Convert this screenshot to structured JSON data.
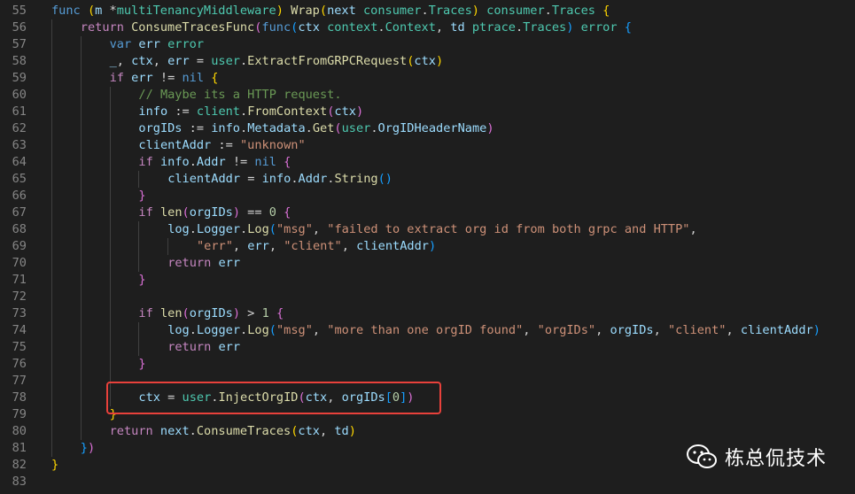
{
  "editor": {
    "lines": [
      {
        "n": "55",
        "indent": 0,
        "tokens": [
          [
            "kw",
            "func"
          ],
          [
            "pl",
            " "
          ],
          [
            "br1",
            "("
          ],
          [
            "var",
            "m"
          ],
          [
            "pl",
            " *"
          ],
          [
            "ty",
            "multiTenancyMiddleware"
          ],
          [
            "br1",
            ")"
          ],
          [
            "pl",
            " "
          ],
          [
            "fn",
            "Wrap"
          ],
          [
            "br1",
            "("
          ],
          [
            "var",
            "next"
          ],
          [
            "pl",
            " "
          ],
          [
            "ty",
            "consumer"
          ],
          [
            "pl",
            "."
          ],
          [
            "ty",
            "Traces"
          ],
          [
            "br1",
            ")"
          ],
          [
            "pl",
            " "
          ],
          [
            "ty",
            "consumer"
          ],
          [
            "pl",
            "."
          ],
          [
            "ty",
            "Traces"
          ],
          [
            "pl",
            " "
          ],
          [
            "br1",
            "{"
          ]
        ]
      },
      {
        "n": "56",
        "indent": 1,
        "tokens": [
          [
            "ctl",
            "return"
          ],
          [
            "pl",
            " "
          ],
          [
            "fn",
            "ConsumeTracesFunc"
          ],
          [
            "br2",
            "("
          ],
          [
            "kw",
            "func"
          ],
          [
            "br3",
            "("
          ],
          [
            "var",
            "ctx"
          ],
          [
            "pl",
            " "
          ],
          [
            "ty",
            "context"
          ],
          [
            "pl",
            "."
          ],
          [
            "ty",
            "Context"
          ],
          [
            "pl",
            ", "
          ],
          [
            "var",
            "td"
          ],
          [
            "pl",
            " "
          ],
          [
            "ty",
            "ptrace"
          ],
          [
            "pl",
            "."
          ],
          [
            "ty",
            "Traces"
          ],
          [
            "br3",
            ")"
          ],
          [
            "pl",
            " "
          ],
          [
            "ty",
            "error"
          ],
          [
            "pl",
            " "
          ],
          [
            "br3",
            "{"
          ]
        ]
      },
      {
        "n": "57",
        "indent": 2,
        "tokens": [
          [
            "kw",
            "var"
          ],
          [
            "pl",
            " "
          ],
          [
            "var",
            "err"
          ],
          [
            "pl",
            " "
          ],
          [
            "ty",
            "error"
          ]
        ]
      },
      {
        "n": "58",
        "indent": 2,
        "tokens": [
          [
            "var",
            "_"
          ],
          [
            "pl",
            ", "
          ],
          [
            "var",
            "ctx"
          ],
          [
            "pl",
            ", "
          ],
          [
            "var",
            "err"
          ],
          [
            "pl",
            " = "
          ],
          [
            "ty",
            "user"
          ],
          [
            "pl",
            "."
          ],
          [
            "fn",
            "ExtractFromGRPCRequest"
          ],
          [
            "br1",
            "("
          ],
          [
            "var",
            "ctx"
          ],
          [
            "br1",
            ")"
          ]
        ]
      },
      {
        "n": "59",
        "indent": 2,
        "tokens": [
          [
            "ctl",
            "if"
          ],
          [
            "pl",
            " "
          ],
          [
            "var",
            "err"
          ],
          [
            "pl",
            " != "
          ],
          [
            "kw",
            "nil"
          ],
          [
            "pl",
            " "
          ],
          [
            "br1",
            "{"
          ]
        ]
      },
      {
        "n": "60",
        "indent": 3,
        "tokens": [
          [
            "com",
            "// Maybe its a HTTP request."
          ]
        ]
      },
      {
        "n": "61",
        "indent": 3,
        "tokens": [
          [
            "var",
            "info"
          ],
          [
            "pl",
            " := "
          ],
          [
            "ty",
            "client"
          ],
          [
            "pl",
            "."
          ],
          [
            "fn",
            "FromContext"
          ],
          [
            "br2",
            "("
          ],
          [
            "var",
            "ctx"
          ],
          [
            "br2",
            ")"
          ]
        ]
      },
      {
        "n": "62",
        "indent": 3,
        "tokens": [
          [
            "var",
            "orgIDs"
          ],
          [
            "pl",
            " := "
          ],
          [
            "var",
            "info"
          ],
          [
            "pl",
            "."
          ],
          [
            "var",
            "Metadata"
          ],
          [
            "pl",
            "."
          ],
          [
            "fn",
            "Get"
          ],
          [
            "br2",
            "("
          ],
          [
            "ty",
            "user"
          ],
          [
            "pl",
            "."
          ],
          [
            "var",
            "OrgIDHeaderName"
          ],
          [
            "br2",
            ")"
          ]
        ]
      },
      {
        "n": "63",
        "indent": 3,
        "tokens": [
          [
            "var",
            "clientAddr"
          ],
          [
            "pl",
            " := "
          ],
          [
            "str",
            "\"unknown\""
          ]
        ]
      },
      {
        "n": "64",
        "indent": 3,
        "tokens": [
          [
            "ctl",
            "if"
          ],
          [
            "pl",
            " "
          ],
          [
            "var",
            "info"
          ],
          [
            "pl",
            "."
          ],
          [
            "var",
            "Addr"
          ],
          [
            "pl",
            " != "
          ],
          [
            "kw",
            "nil"
          ],
          [
            "pl",
            " "
          ],
          [
            "br2",
            "{"
          ]
        ]
      },
      {
        "n": "65",
        "indent": 4,
        "tokens": [
          [
            "var",
            "clientAddr"
          ],
          [
            "pl",
            " = "
          ],
          [
            "var",
            "info"
          ],
          [
            "pl",
            "."
          ],
          [
            "var",
            "Addr"
          ],
          [
            "pl",
            "."
          ],
          [
            "fn",
            "String"
          ],
          [
            "br3",
            "()"
          ]
        ]
      },
      {
        "n": "66",
        "indent": 3,
        "tokens": [
          [
            "br2",
            "}"
          ]
        ]
      },
      {
        "n": "67",
        "indent": 3,
        "tokens": [
          [
            "ctl",
            "if"
          ],
          [
            "pl",
            " "
          ],
          [
            "fn",
            "len"
          ],
          [
            "br2",
            "("
          ],
          [
            "var",
            "orgIDs"
          ],
          [
            "br2",
            ")"
          ],
          [
            "pl",
            " == "
          ],
          [
            "num",
            "0"
          ],
          [
            "pl",
            " "
          ],
          [
            "br2",
            "{"
          ]
        ]
      },
      {
        "n": "68",
        "indent": 4,
        "tokens": [
          [
            "var",
            "log"
          ],
          [
            "pl",
            "."
          ],
          [
            "var",
            "Logger"
          ],
          [
            "pl",
            "."
          ],
          [
            "fn",
            "Log"
          ],
          [
            "br3",
            "("
          ],
          [
            "str",
            "\"msg\""
          ],
          [
            "pl",
            ", "
          ],
          [
            "str",
            "\"failed to extract org id from both grpc and HTTP\""
          ],
          [
            "pl",
            ","
          ]
        ]
      },
      {
        "n": "69",
        "indent": 5,
        "tokens": [
          [
            "str",
            "\"err\""
          ],
          [
            "pl",
            ", "
          ],
          [
            "var",
            "err"
          ],
          [
            "pl",
            ", "
          ],
          [
            "str",
            "\"client\""
          ],
          [
            "pl",
            ", "
          ],
          [
            "var",
            "clientAddr"
          ],
          [
            "br3",
            ")"
          ]
        ]
      },
      {
        "n": "70",
        "indent": 4,
        "tokens": [
          [
            "ctl",
            "return"
          ],
          [
            "pl",
            " "
          ],
          [
            "var",
            "err"
          ]
        ]
      },
      {
        "n": "71",
        "indent": 3,
        "tokens": [
          [
            "br2",
            "}"
          ]
        ]
      },
      {
        "n": "72",
        "indent": 3,
        "tokens": []
      },
      {
        "n": "73",
        "indent": 3,
        "tokens": [
          [
            "ctl",
            "if"
          ],
          [
            "pl",
            " "
          ],
          [
            "fn",
            "len"
          ],
          [
            "br2",
            "("
          ],
          [
            "var",
            "orgIDs"
          ],
          [
            "br2",
            ")"
          ],
          [
            "pl",
            " > "
          ],
          [
            "num",
            "1"
          ],
          [
            "pl",
            " "
          ],
          [
            "br2",
            "{"
          ]
        ]
      },
      {
        "n": "74",
        "indent": 4,
        "tokens": [
          [
            "var",
            "log"
          ],
          [
            "pl",
            "."
          ],
          [
            "var",
            "Logger"
          ],
          [
            "pl",
            "."
          ],
          [
            "fn",
            "Log"
          ],
          [
            "br3",
            "("
          ],
          [
            "str",
            "\"msg\""
          ],
          [
            "pl",
            ", "
          ],
          [
            "str",
            "\"more than one orgID found\""
          ],
          [
            "pl",
            ", "
          ],
          [
            "str",
            "\"orgIDs\""
          ],
          [
            "pl",
            ", "
          ],
          [
            "var",
            "orgIDs"
          ],
          [
            "pl",
            ", "
          ],
          [
            "str",
            "\"client\""
          ],
          [
            "pl",
            ", "
          ],
          [
            "var",
            "clientAddr"
          ],
          [
            "br3",
            ")"
          ]
        ]
      },
      {
        "n": "75",
        "indent": 4,
        "tokens": [
          [
            "ctl",
            "return"
          ],
          [
            "pl",
            " "
          ],
          [
            "var",
            "err"
          ]
        ]
      },
      {
        "n": "76",
        "indent": 3,
        "tokens": [
          [
            "br2",
            "}"
          ]
        ]
      },
      {
        "n": "77",
        "indent": 3,
        "tokens": []
      },
      {
        "n": "78",
        "indent": 3,
        "tokens": [
          [
            "var",
            "ctx"
          ],
          [
            "pl",
            " = "
          ],
          [
            "ty",
            "user"
          ],
          [
            "pl",
            "."
          ],
          [
            "fn",
            "InjectOrgID"
          ],
          [
            "br2",
            "("
          ],
          [
            "var",
            "ctx"
          ],
          [
            "pl",
            ", "
          ],
          [
            "var",
            "orgIDs"
          ],
          [
            "br3",
            "["
          ],
          [
            "num",
            "0"
          ],
          [
            "br3",
            "]"
          ],
          [
            "br2",
            ")"
          ]
        ]
      },
      {
        "n": "79",
        "indent": 2,
        "tokens": [
          [
            "br1",
            "}"
          ]
        ]
      },
      {
        "n": "80",
        "indent": 2,
        "tokens": [
          [
            "ctl",
            "return"
          ],
          [
            "pl",
            " "
          ],
          [
            "var",
            "next"
          ],
          [
            "pl",
            "."
          ],
          [
            "fn",
            "ConsumeTraces"
          ],
          [
            "br1",
            "("
          ],
          [
            "var",
            "ctx"
          ],
          [
            "pl",
            ", "
          ],
          [
            "var",
            "td"
          ],
          [
            "br1",
            ")"
          ]
        ]
      },
      {
        "n": "81",
        "indent": 1,
        "tokens": [
          [
            "br3",
            "}"
          ],
          [
            "br2",
            ")"
          ]
        ]
      },
      {
        "n": "82",
        "indent": 0,
        "tokens": [
          [
            "br1",
            "}"
          ]
        ]
      },
      {
        "n": "83",
        "indent": 0,
        "tokens": []
      }
    ]
  },
  "watermark": {
    "text": "栋总侃技术",
    "icon": "wechat-icon"
  }
}
